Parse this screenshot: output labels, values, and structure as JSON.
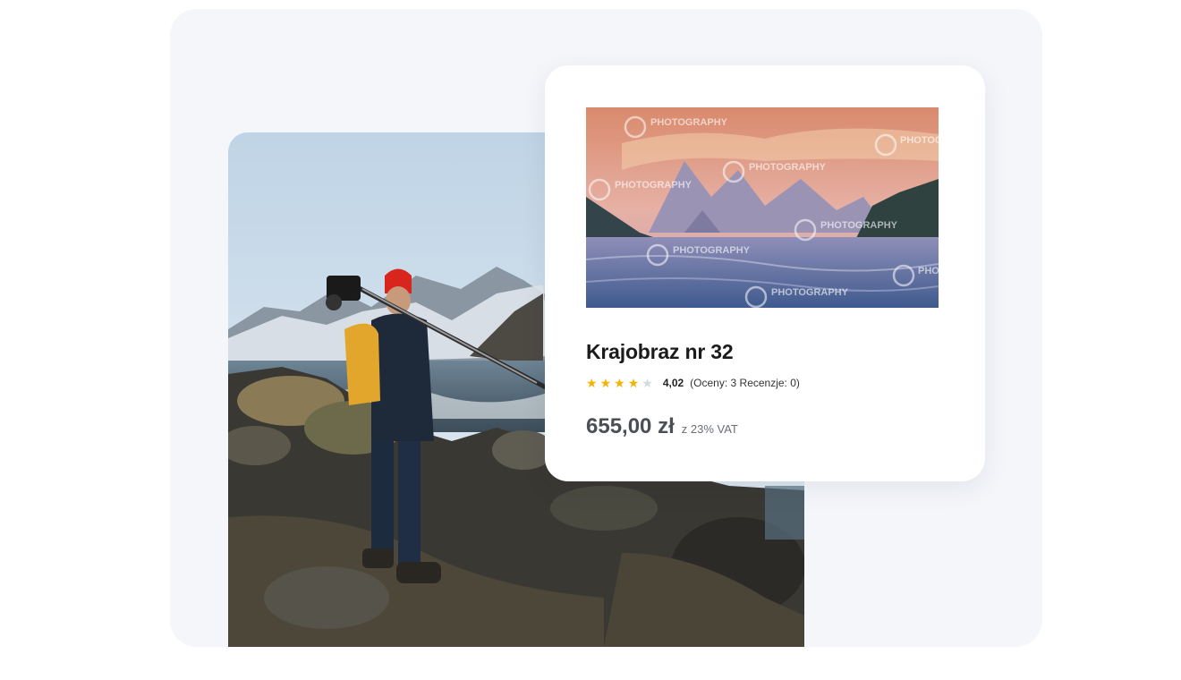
{
  "product": {
    "title": "Krajobraz nr 32",
    "rating": {
      "value": 4.02,
      "stars_filled": 4,
      "stars_total": 5,
      "value_text": "4,02",
      "meta": "(Oceny: 3 Recenzje: 0)"
    },
    "price": "655,00 zł",
    "vat_note": "z 23% VAT",
    "image_watermark": "PHOTOGRAPHY"
  },
  "colors": {
    "star_filled": "#f5b301",
    "star_empty": "#d5d8de",
    "card_background": "#ffffff",
    "stage_background": "#f4f6fa"
  },
  "icons": {
    "star": "star-icon",
    "watermark": "camera-shutter-icon"
  }
}
